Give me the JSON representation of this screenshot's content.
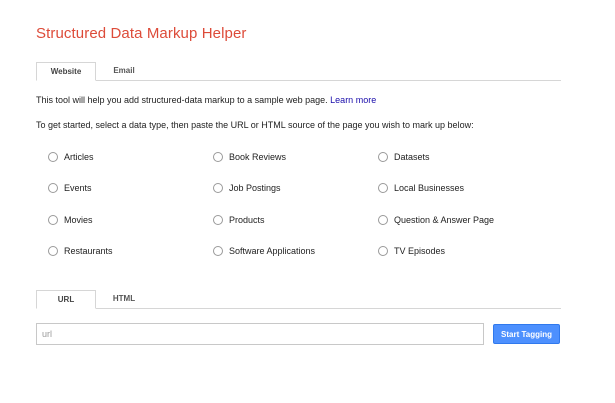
{
  "page": {
    "title": "Structured Data Markup Helper"
  },
  "source_tabs": [
    {
      "label": "Website",
      "active": true
    },
    {
      "label": "Email",
      "active": false
    }
  ],
  "intro": {
    "text": "This tool will help you add structured-data markup to a sample web page. ",
    "link_label": "Learn more"
  },
  "instruction": "To get started, select a data type, then paste the URL or HTML source of the page you wish to mark up below:",
  "data_types": [
    {
      "label": "Articles",
      "checked": false
    },
    {
      "label": "Book Reviews",
      "checked": false
    },
    {
      "label": "Datasets",
      "checked": false
    },
    {
      "label": "Events",
      "checked": false
    },
    {
      "label": "Job Postings",
      "checked": false
    },
    {
      "label": "Local Businesses",
      "checked": false
    },
    {
      "label": "Movies",
      "checked": false
    },
    {
      "label": "Products",
      "checked": false
    },
    {
      "label": "Question & Answer Page",
      "checked": false
    },
    {
      "label": "Restaurants",
      "checked": false
    },
    {
      "label": "Software Applications",
      "checked": false
    },
    {
      "label": "TV Episodes",
      "checked": false
    }
  ],
  "input_tabs": [
    {
      "label": "URL",
      "active": true
    },
    {
      "label": "HTML",
      "active": false
    }
  ],
  "url_field": {
    "value": "",
    "placeholder": "url"
  },
  "start_button": {
    "label": "Start Tagging"
  },
  "colors": {
    "title": "#dd4b39",
    "link": "#1a0dab",
    "button": "#4d90fe"
  }
}
